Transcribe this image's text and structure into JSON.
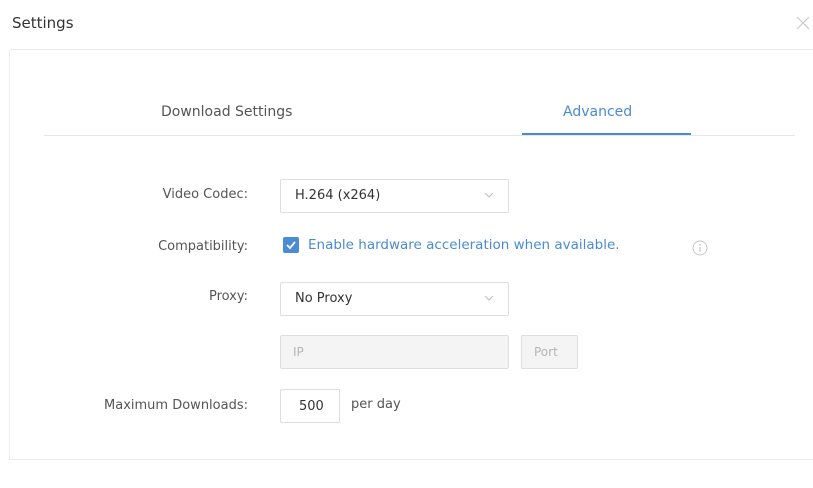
{
  "window": {
    "title": "Settings",
    "close_icon": "close-icon"
  },
  "tabs": [
    {
      "label": "Download Settings",
      "active": false
    },
    {
      "label": "Advanced",
      "active": true
    }
  ],
  "colors": {
    "accent": "#4a8bd4",
    "text": "#555555",
    "border": "#dedede",
    "disabled_bg": "#f4f4f4"
  },
  "form": {
    "video_codec": {
      "label": "Video Codec:",
      "value": "H.264 (x264)",
      "icon": "chevron-down-icon"
    },
    "compatibility": {
      "label": "Compatibility:",
      "checkbox_label": "Enable hardware acceleration when available.",
      "checked": true,
      "info_icon": "info-icon"
    },
    "proxy": {
      "label": "Proxy:",
      "value": "No Proxy",
      "icon": "chevron-down-icon",
      "ip_placeholder": "IP",
      "port_placeholder": "Port"
    },
    "max_downloads": {
      "label": "Maximum Downloads:",
      "value": "500",
      "suffix": "per day"
    }
  }
}
